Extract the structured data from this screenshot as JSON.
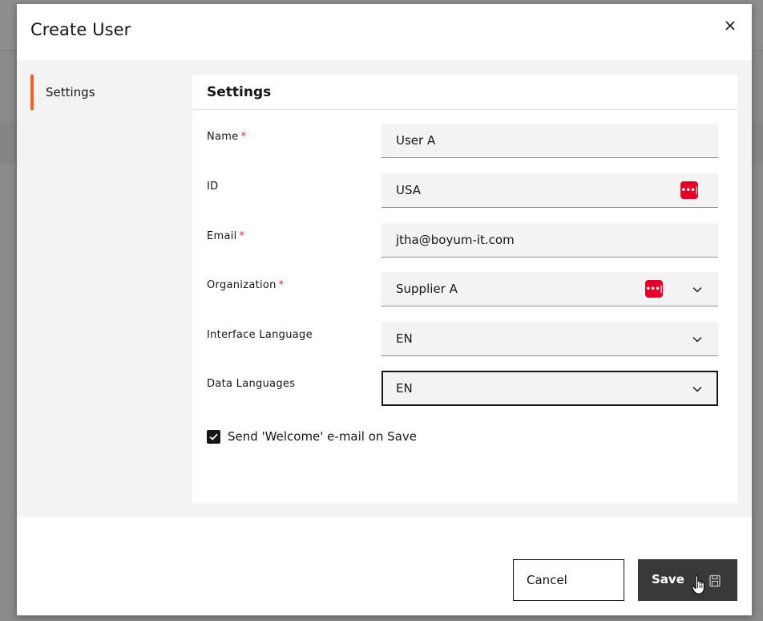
{
  "dialog": {
    "title": "Create User",
    "close_icon": "close-icon"
  },
  "side_nav": {
    "items": [
      {
        "label": "Settings",
        "active": true
      }
    ],
    "accent_color": "#f35d1e"
  },
  "panel": {
    "title": "Settings",
    "fields": {
      "name": {
        "label": "Name",
        "required": "*",
        "value": "User A"
      },
      "id": {
        "label": "ID",
        "value": "USA",
        "icon": "password-manager-icon"
      },
      "email": {
        "label": "Email",
        "required": "*",
        "value": "jtha@boyum-it.com"
      },
      "organization": {
        "label": "Organization",
        "required": "*",
        "value": "Supplier A",
        "icon": "password-manager-icon"
      },
      "interface_language": {
        "label": "Interface Language",
        "value": "EN"
      },
      "data_languages": {
        "label": "Data Languages",
        "value": "EN"
      }
    },
    "welcome_email": {
      "label": "Send 'Welcome' e-mail on Save",
      "checked": true
    }
  },
  "footer": {
    "cancel_label": "Cancel",
    "save_label": "Save"
  },
  "colors": {
    "required": "#da1e28",
    "primary_button": "#393939",
    "password_icon": "#e0002a"
  }
}
